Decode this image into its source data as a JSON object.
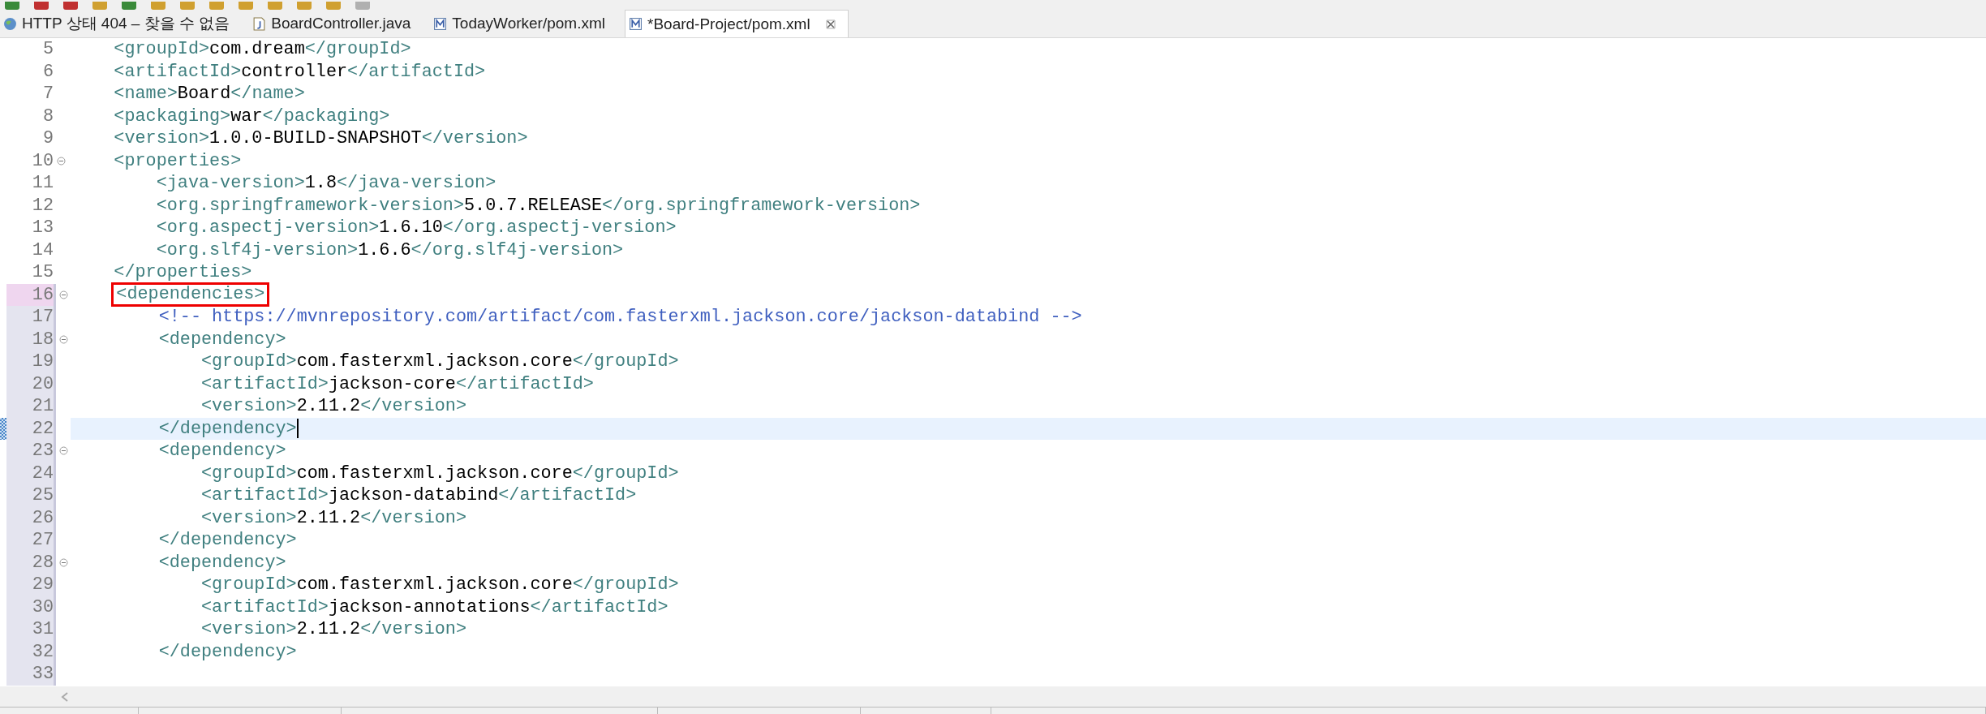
{
  "tabs": [
    {
      "label": "HTTP 상태 404 – 찾을 수 없음",
      "kind": "web",
      "selected": false
    },
    {
      "label": "BoardController.java",
      "kind": "java",
      "selected": false
    },
    {
      "label": "TodayWorker/pom.xml",
      "kind": "xml",
      "selected": false
    },
    {
      "label": "*Board-Project/pom.xml",
      "kind": "xml",
      "selected": true
    }
  ],
  "editor": {
    "lines": [
      {
        "number": "5",
        "foldable": false,
        "in_range": false,
        "range_start": false,
        "current": false,
        "tokens": [
          {
            "kind": "tag",
            "text": "    <groupId>"
          },
          {
            "kind": "text",
            "text": "com.dream"
          },
          {
            "kind": "tag",
            "text": "</groupId>"
          }
        ]
      },
      {
        "number": "6",
        "foldable": false,
        "in_range": false,
        "range_start": false,
        "current": false,
        "tokens": [
          {
            "kind": "tag",
            "text": "    <artifactId>"
          },
          {
            "kind": "text",
            "text": "controller"
          },
          {
            "kind": "tag",
            "text": "</artifactId>"
          }
        ]
      },
      {
        "number": "7",
        "foldable": false,
        "in_range": false,
        "range_start": false,
        "current": false,
        "tokens": [
          {
            "kind": "tag",
            "text": "    <name>"
          },
          {
            "kind": "text",
            "text": "Board"
          },
          {
            "kind": "tag",
            "text": "</name>"
          }
        ]
      },
      {
        "number": "8",
        "foldable": false,
        "in_range": false,
        "range_start": false,
        "current": false,
        "tokens": [
          {
            "kind": "tag",
            "text": "    <packaging>"
          },
          {
            "kind": "text",
            "text": "war"
          },
          {
            "kind": "tag",
            "text": "</packaging>"
          }
        ]
      },
      {
        "number": "9",
        "foldable": false,
        "in_range": false,
        "range_start": false,
        "current": false,
        "tokens": [
          {
            "kind": "tag",
            "text": "    <version>"
          },
          {
            "kind": "text",
            "text": "1.0.0-BUILD-SNAPSHOT"
          },
          {
            "kind": "tag",
            "text": "</version>"
          }
        ]
      },
      {
        "number": "10",
        "foldable": true,
        "in_range": false,
        "range_start": false,
        "current": false,
        "tokens": [
          {
            "kind": "tag",
            "text": "    <properties>"
          }
        ]
      },
      {
        "number": "11",
        "foldable": false,
        "in_range": false,
        "range_start": false,
        "current": false,
        "tokens": [
          {
            "kind": "tag",
            "text": "        <java-version>"
          },
          {
            "kind": "text",
            "text": "1.8"
          },
          {
            "kind": "tag",
            "text": "</java-version>"
          }
        ]
      },
      {
        "number": "12",
        "foldable": false,
        "in_range": false,
        "range_start": false,
        "current": false,
        "tokens": [
          {
            "kind": "tag",
            "text": "        <org.springframework-version>"
          },
          {
            "kind": "text",
            "text": "5.0.7.RELEASE"
          },
          {
            "kind": "tag",
            "text": "</org.springframework-version>"
          }
        ]
      },
      {
        "number": "13",
        "foldable": false,
        "in_range": false,
        "range_start": false,
        "current": false,
        "tokens": [
          {
            "kind": "tag",
            "text": "        <org.aspectj-version>"
          },
          {
            "kind": "text",
            "text": "1.6.10"
          },
          {
            "kind": "tag",
            "text": "</org.aspectj-version>"
          }
        ]
      },
      {
        "number": "14",
        "foldable": false,
        "in_range": false,
        "range_start": false,
        "current": false,
        "tokens": [
          {
            "kind": "tag",
            "text": "        <org.slf4j-version>"
          },
          {
            "kind": "text",
            "text": "1.6.6"
          },
          {
            "kind": "tag",
            "text": "</org.slf4j-version>"
          }
        ]
      },
      {
        "number": "15",
        "foldable": false,
        "in_range": false,
        "range_start": false,
        "current": false,
        "tokens": [
          {
            "kind": "tag",
            "text": "    </properties>"
          }
        ]
      },
      {
        "number": "16",
        "foldable": true,
        "in_range": true,
        "range_start": true,
        "current": false,
        "tokens": [
          {
            "kind": "boxed_tag",
            "text": "    <dependencies>"
          }
        ]
      },
      {
        "number": "17",
        "foldable": false,
        "in_range": true,
        "range_start": false,
        "current": false,
        "tokens": [
          {
            "kind": "comment",
            "text": "        <!-- https://mvnrepository.com/artifact/com.fasterxml.jackson.core/jackson-databind -->"
          }
        ]
      },
      {
        "number": "18",
        "foldable": true,
        "in_range": true,
        "range_start": false,
        "current": false,
        "tokens": [
          {
            "kind": "tag",
            "text": "        <dependency>"
          }
        ]
      },
      {
        "number": "19",
        "foldable": false,
        "in_range": true,
        "range_start": false,
        "current": false,
        "tokens": [
          {
            "kind": "tag",
            "text": "            <groupId>"
          },
          {
            "kind": "text",
            "text": "com.fasterxml.jackson.core"
          },
          {
            "kind": "tag",
            "text": "</groupId>"
          }
        ]
      },
      {
        "number": "20",
        "foldable": false,
        "in_range": true,
        "range_start": false,
        "current": false,
        "tokens": [
          {
            "kind": "tag",
            "text": "            <artifactId>"
          },
          {
            "kind": "text",
            "text": "jackson-core"
          },
          {
            "kind": "tag",
            "text": "</artifactId>"
          }
        ]
      },
      {
        "number": "21",
        "foldable": false,
        "in_range": true,
        "range_start": false,
        "current": false,
        "tokens": [
          {
            "kind": "tag",
            "text": "            <version>"
          },
          {
            "kind": "text",
            "text": "2.11.2"
          },
          {
            "kind": "tag",
            "text": "</version>"
          }
        ]
      },
      {
        "number": "22",
        "foldable": false,
        "in_range": true,
        "range_start": false,
        "current": true,
        "tokens": [
          {
            "kind": "tag",
            "text": "        </dependency>"
          }
        ]
      },
      {
        "number": "23",
        "foldable": true,
        "in_range": true,
        "range_start": false,
        "current": false,
        "tokens": [
          {
            "kind": "tag",
            "text": "        <dependency>"
          }
        ]
      },
      {
        "number": "24",
        "foldable": false,
        "in_range": true,
        "range_start": false,
        "current": false,
        "tokens": [
          {
            "kind": "tag",
            "text": "            <groupId>"
          },
          {
            "kind": "text",
            "text": "com.fasterxml.jackson.core"
          },
          {
            "kind": "tag",
            "text": "</groupId>"
          }
        ]
      },
      {
        "number": "25",
        "foldable": false,
        "in_range": true,
        "range_start": false,
        "current": false,
        "tokens": [
          {
            "kind": "tag",
            "text": "            <artifactId>"
          },
          {
            "kind": "text",
            "text": "jackson-databind"
          },
          {
            "kind": "tag",
            "text": "</artifactId>"
          }
        ]
      },
      {
        "number": "26",
        "foldable": false,
        "in_range": true,
        "range_start": false,
        "current": false,
        "tokens": [
          {
            "kind": "tag",
            "text": "            <version>"
          },
          {
            "kind": "text",
            "text": "2.11.2"
          },
          {
            "kind": "tag",
            "text": "</version>"
          }
        ]
      },
      {
        "number": "27",
        "foldable": false,
        "in_range": true,
        "range_start": false,
        "current": false,
        "tokens": [
          {
            "kind": "tag",
            "text": "        </dependency>"
          }
        ]
      },
      {
        "number": "28",
        "foldable": true,
        "in_range": true,
        "range_start": false,
        "current": false,
        "tokens": [
          {
            "kind": "tag",
            "text": "        <dependency>"
          }
        ]
      },
      {
        "number": "29",
        "foldable": false,
        "in_range": true,
        "range_start": false,
        "current": false,
        "tokens": [
          {
            "kind": "tag",
            "text": "            <groupId>"
          },
          {
            "kind": "text",
            "text": "com.fasterxml.jackson.core"
          },
          {
            "kind": "tag",
            "text": "</groupId>"
          }
        ]
      },
      {
        "number": "30",
        "foldable": false,
        "in_range": true,
        "range_start": false,
        "current": false,
        "tokens": [
          {
            "kind": "tag",
            "text": "            <artifactId>"
          },
          {
            "kind": "text",
            "text": "jackson-annotations"
          },
          {
            "kind": "tag",
            "text": "</artifactId>"
          }
        ]
      },
      {
        "number": "31",
        "foldable": false,
        "in_range": true,
        "range_start": false,
        "current": false,
        "tokens": [
          {
            "kind": "tag",
            "text": "            <version>"
          },
          {
            "kind": "text",
            "text": "2.11.2"
          },
          {
            "kind": "tag",
            "text": "</version>"
          }
        ]
      },
      {
        "number": "32",
        "foldable": false,
        "in_range": true,
        "range_start": false,
        "current": false,
        "tokens": [
          {
            "kind": "tag",
            "text": "        </dependency>"
          }
        ]
      },
      {
        "number": "33",
        "foldable": false,
        "in_range": true,
        "range_start": false,
        "current": false
      }
    ]
  }
}
